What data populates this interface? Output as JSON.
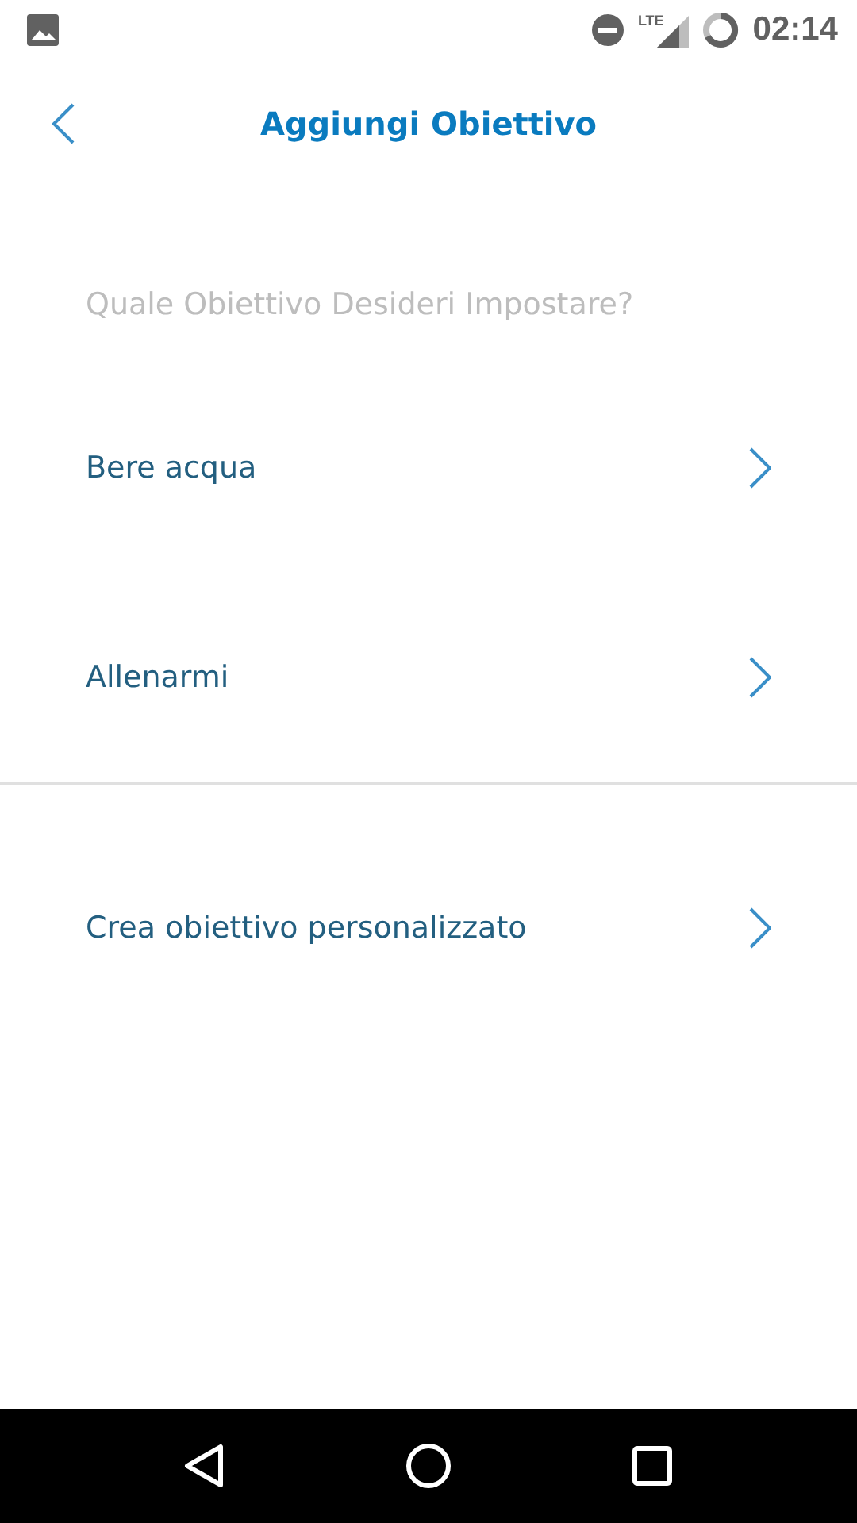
{
  "status_bar": {
    "network": "LTE",
    "time": "02:14"
  },
  "header": {
    "title": "Aggiungi Obiettivo"
  },
  "question": "Quale Obiettivo Desideri Impostare?",
  "sections": [
    {
      "items": [
        {
          "label": "Bere acqua"
        },
        {
          "label": "Allenarmi"
        }
      ]
    },
    {
      "items": [
        {
          "label": "Crea obiettivo personalizzato"
        }
      ]
    }
  ]
}
